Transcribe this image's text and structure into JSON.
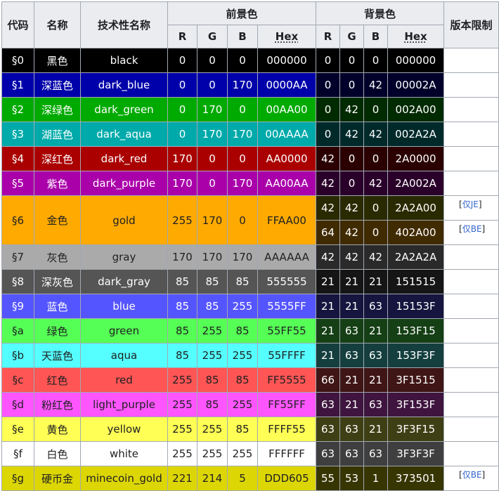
{
  "headers": {
    "code": "代码",
    "name": "名称",
    "tech_name": "技术性名称",
    "foreground": "前景色",
    "background": "背景色",
    "limit": "版本限制",
    "r": "R",
    "g": "G",
    "b": "B",
    "hex": "Hex"
  },
  "colors": {
    "light_text": "#ffffff",
    "dark_text": "#202122",
    "header_bg": "#eaecf0",
    "note_link": "#3366cc"
  },
  "rows": [
    {
      "code": "§0",
      "name": "黑色",
      "tech": "black",
      "fg_r": "0",
      "fg_g": "0",
      "fg_b": "0",
      "fg_hex": "000000",
      "fill": "#000000",
      "text": "#ffffff",
      "bgs": [
        {
          "r": "0",
          "g": "0",
          "b": "0",
          "hex": "000000",
          "fill": "#000000",
          "text": "#ffffff",
          "note": ""
        }
      ]
    },
    {
      "code": "§1",
      "name": "深蓝色",
      "tech": "dark_blue",
      "fg_r": "0",
      "fg_g": "0",
      "fg_b": "170",
      "fg_hex": "0000AA",
      "fill": "#0000aa",
      "text": "#ffffff",
      "bgs": [
        {
          "r": "0",
          "g": "0",
          "b": "42",
          "hex": "00002A",
          "fill": "#00002a",
          "text": "#ffffff",
          "note": ""
        }
      ]
    },
    {
      "code": "§2",
      "name": "深绿色",
      "tech": "dark_green",
      "fg_r": "0",
      "fg_g": "170",
      "fg_b": "0",
      "fg_hex": "00AA00",
      "fill": "#00aa00",
      "text": "#ffffff",
      "bgs": [
        {
          "r": "0",
          "g": "42",
          "b": "0",
          "hex": "002A00",
          "fill": "#002a00",
          "text": "#ffffff",
          "note": ""
        }
      ]
    },
    {
      "code": "§3",
      "name": "湖蓝色",
      "tech": "dark_aqua",
      "fg_r": "0",
      "fg_g": "170",
      "fg_b": "170",
      "fg_hex": "00AAAA",
      "fill": "#00aaaa",
      "text": "#ffffff",
      "bgs": [
        {
          "r": "0",
          "g": "42",
          "b": "42",
          "hex": "002A2A",
          "fill": "#002a2a",
          "text": "#ffffff",
          "note": ""
        }
      ]
    },
    {
      "code": "§4",
      "name": "深红色",
      "tech": "dark_red",
      "fg_r": "170",
      "fg_g": "0",
      "fg_b": "0",
      "fg_hex": "AA0000",
      "fill": "#aa0000",
      "text": "#ffffff",
      "bgs": [
        {
          "r": "42",
          "g": "0",
          "b": "0",
          "hex": "2A0000",
          "fill": "#2a0000",
          "text": "#ffffff",
          "note": ""
        }
      ]
    },
    {
      "code": "§5",
      "name": "紫色",
      "tech": "dark_purple",
      "fg_r": "170",
      "fg_g": "0",
      "fg_b": "170",
      "fg_hex": "AA00AA",
      "fill": "#aa00aa",
      "text": "#ffffff",
      "bgs": [
        {
          "r": "42",
          "g": "0",
          "b": "42",
          "hex": "2A002A",
          "fill": "#2a002a",
          "text": "#ffffff",
          "note": ""
        }
      ]
    },
    {
      "code": "§6",
      "name": "金色",
      "tech": "gold",
      "fg_r": "255",
      "fg_g": "170",
      "fg_b": "0",
      "fg_hex": "FFAA00",
      "fill": "#ffaa00",
      "text": "#202122",
      "bgs": [
        {
          "r": "42",
          "g": "42",
          "b": "0",
          "hex": "2A2A00",
          "fill": "#2a2a00",
          "text": "#ffffff",
          "note": "仅JE"
        },
        {
          "r": "64",
          "g": "42",
          "b": "0",
          "hex": "402A00",
          "fill": "#402a00",
          "text": "#ffffff",
          "note": "仅BE"
        }
      ]
    },
    {
      "code": "§7",
      "name": "灰色",
      "tech": "gray",
      "fg_r": "170",
      "fg_g": "170",
      "fg_b": "170",
      "fg_hex": "AAAAAA",
      "fill": "#aaaaaa",
      "text": "#202122",
      "bgs": [
        {
          "r": "42",
          "g": "42",
          "b": "42",
          "hex": "2A2A2A",
          "fill": "#2a2a2a",
          "text": "#ffffff",
          "note": ""
        }
      ]
    },
    {
      "code": "§8",
      "name": "深灰色",
      "tech": "dark_gray",
      "fg_r": "85",
      "fg_g": "85",
      "fg_b": "85",
      "fg_hex": "555555",
      "fill": "#555555",
      "text": "#ffffff",
      "bgs": [
        {
          "r": "21",
          "g": "21",
          "b": "21",
          "hex": "151515",
          "fill": "#151515",
          "text": "#ffffff",
          "note": ""
        }
      ]
    },
    {
      "code": "§9",
      "name": "蓝色",
      "tech": "blue",
      "fg_r": "85",
      "fg_g": "85",
      "fg_b": "255",
      "fg_hex": "5555FF",
      "fill": "#5555ff",
      "text": "#ffffff",
      "bgs": [
        {
          "r": "21",
          "g": "21",
          "b": "63",
          "hex": "15153F",
          "fill": "#15153f",
          "text": "#ffffff",
          "note": ""
        }
      ]
    },
    {
      "code": "§a",
      "name": "绿色",
      "tech": "green",
      "fg_r": "85",
      "fg_g": "255",
      "fg_b": "85",
      "fg_hex": "55FF55",
      "fill": "#55ff55",
      "text": "#202122",
      "bgs": [
        {
          "r": "21",
          "g": "63",
          "b": "21",
          "hex": "153F15",
          "fill": "#153f15",
          "text": "#ffffff",
          "note": ""
        }
      ]
    },
    {
      "code": "§b",
      "name": "天蓝色",
      "tech": "aqua",
      "fg_r": "85",
      "fg_g": "255",
      "fg_b": "255",
      "fg_hex": "55FFFF",
      "fill": "#55ffff",
      "text": "#202122",
      "bgs": [
        {
          "r": "21",
          "g": "63",
          "b": "63",
          "hex": "153F3F",
          "fill": "#153f3f",
          "text": "#ffffff",
          "note": ""
        }
      ]
    },
    {
      "code": "§c",
      "name": "红色",
      "tech": "red",
      "fg_r": "255",
      "fg_g": "85",
      "fg_b": "85",
      "fg_hex": "FF5555",
      "fill": "#ff5555",
      "text": "#202122",
      "bgs": [
        {
          "r": "66",
          "g": "21",
          "b": "21",
          "hex": "3F1515",
          "fill": "#3f1515",
          "text": "#ffffff",
          "note": ""
        }
      ]
    },
    {
      "code": "§d",
      "name": "粉红色",
      "tech": "light_purple",
      "fg_r": "255",
      "fg_g": "85",
      "fg_b": "255",
      "fg_hex": "FF55FF",
      "fill": "#ff55ff",
      "text": "#202122",
      "bgs": [
        {
          "r": "63",
          "g": "21",
          "b": "63",
          "hex": "3F153F",
          "fill": "#3f153f",
          "text": "#ffffff",
          "note": ""
        }
      ]
    },
    {
      "code": "§e",
      "name": "黄色",
      "tech": "yellow",
      "fg_r": "255",
      "fg_g": "255",
      "fg_b": "85",
      "fg_hex": "FFFF55",
      "fill": "#ffff55",
      "text": "#202122",
      "bgs": [
        {
          "r": "63",
          "g": "63",
          "b": "21",
          "hex": "3F3F15",
          "fill": "#3f3f15",
          "text": "#ffffff",
          "note": ""
        }
      ]
    },
    {
      "code": "§f",
      "name": "白色",
      "tech": "white",
      "fg_r": "255",
      "fg_g": "255",
      "fg_b": "255",
      "fg_hex": "FFFFFF",
      "fill": "#ffffff",
      "text": "#202122",
      "bgs": [
        {
          "r": "63",
          "g": "63",
          "b": "63",
          "hex": "3F3F3F",
          "fill": "#3f3f3f",
          "text": "#ffffff",
          "note": ""
        }
      ]
    },
    {
      "code": "§g",
      "name": "硬币金",
      "tech": "minecoin_gold",
      "fg_r": "221",
      "fg_g": "214",
      "fg_b": "5",
      "fg_hex": "DDD605",
      "fill": "#ddd605",
      "text": "#202122",
      "bgs": [
        {
          "r": "55",
          "g": "53",
          "b": "1",
          "hex": "373501",
          "fill": "#373501",
          "text": "#ffffff",
          "note": "仅BE"
        }
      ]
    }
  ]
}
